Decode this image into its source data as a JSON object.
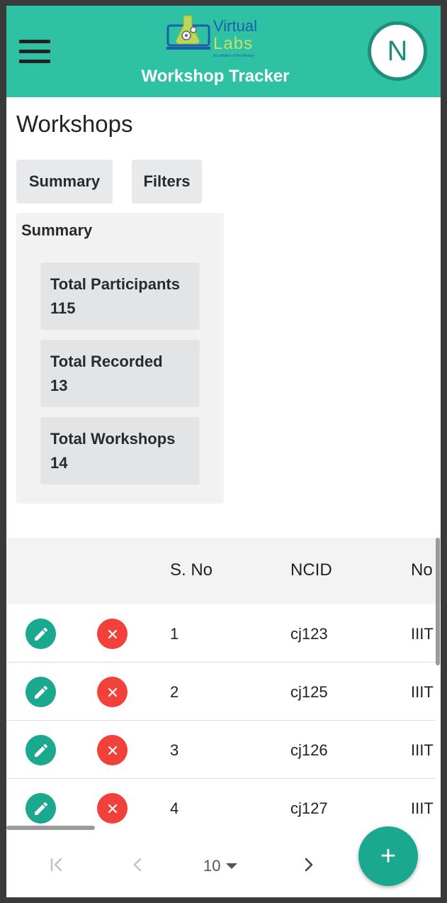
{
  "header": {
    "title": "Workshop Tracker",
    "logo_line1": "Virtual",
    "logo_line2": "Labs",
    "logo_tagline": "An initiative of the Ministry",
    "avatar_initial": "N",
    "bg_color": "#2ec1a4"
  },
  "page": {
    "title": "Workshops",
    "tabs": [
      {
        "label": "Summary"
      },
      {
        "label": "Filters"
      }
    ]
  },
  "summary": {
    "heading": "Summary",
    "stats": [
      {
        "label": "Total Participants",
        "value": "115"
      },
      {
        "label": "Total Recorded",
        "value": "13"
      },
      {
        "label": "Total Workshops",
        "value": "14"
      }
    ]
  },
  "table": {
    "columns": [
      "",
      "",
      "S. No",
      "NCID",
      "No"
    ],
    "rows": [
      {
        "sno": "1",
        "ncid": "cj123",
        "name": "IIIT"
      },
      {
        "sno": "2",
        "ncid": "cj125",
        "name": "IIIT"
      },
      {
        "sno": "3",
        "ncid": "cj126",
        "name": "IIIT"
      },
      {
        "sno": "4",
        "ncid": "cj127",
        "name": "IIIT"
      }
    ]
  },
  "pagination": {
    "page_size": "10",
    "icons": [
      "first-page-icon",
      "prev-page-icon",
      "next-page-icon",
      "dropdown-arrow-icon"
    ]
  },
  "fab": {
    "label": "+"
  },
  "colors": {
    "accent": "#1aa88f",
    "delete": "#f2413b",
    "header": "#2ec1a4"
  }
}
